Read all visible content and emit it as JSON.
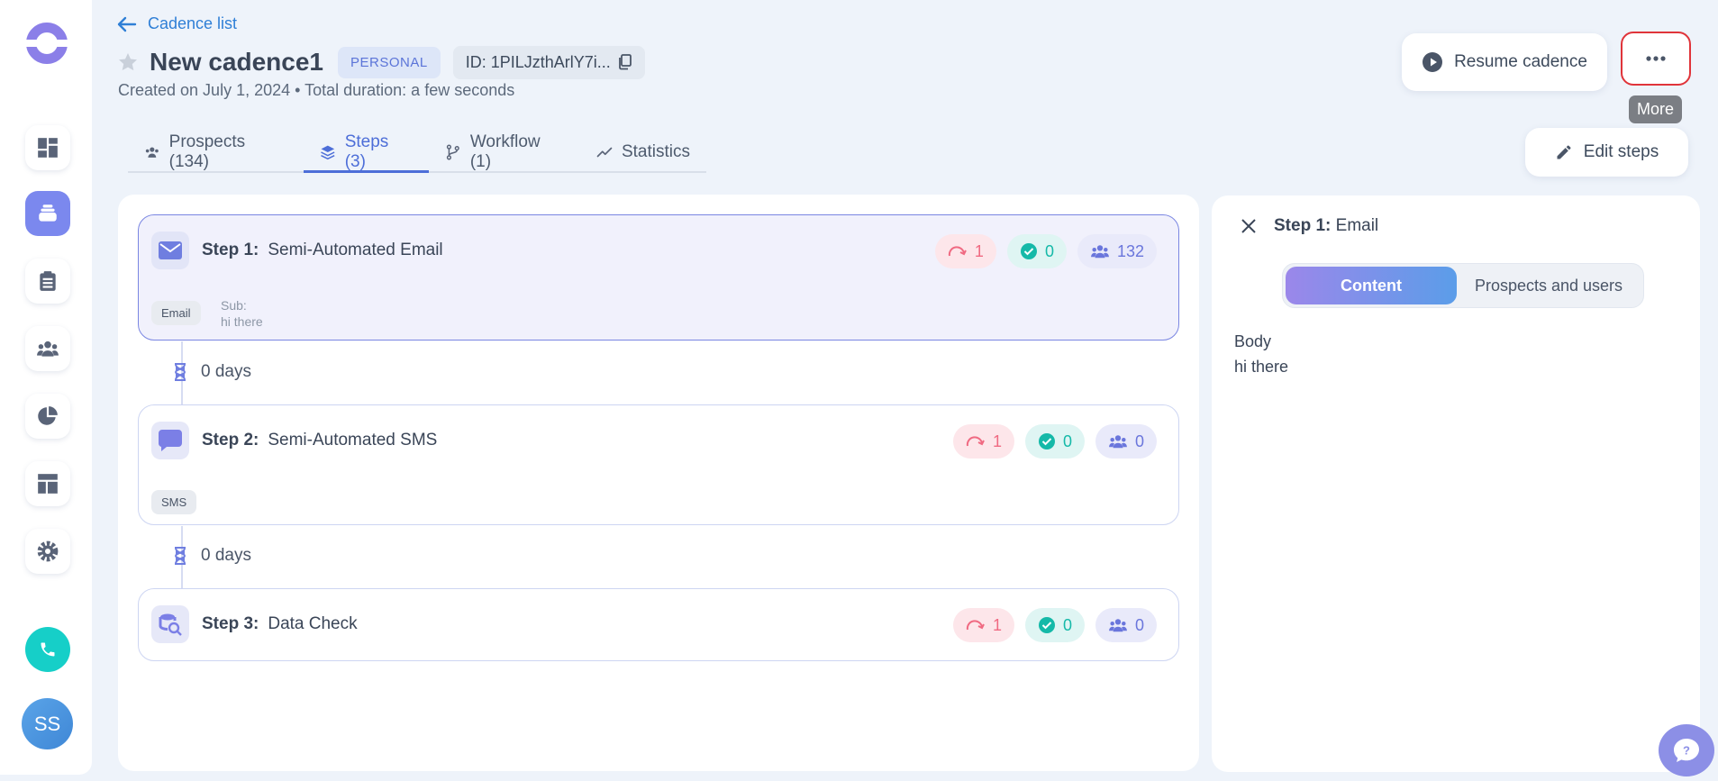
{
  "header": {
    "back_label": "Cadence list",
    "title": "New cadence1",
    "badge": "PERSONAL",
    "id_label": "ID: 1PILJzthArlY7i...",
    "meta": "Created on July 1, 2024 • Total duration: a few seconds",
    "resume_label": "Resume cadence",
    "more_tooltip": "More",
    "edit_label": "Edit steps"
  },
  "tabs": [
    {
      "label": "Prospects (134)",
      "icon": "users-icon",
      "active": false
    },
    {
      "label": "Steps (3)",
      "icon": "layers-icon",
      "active": true
    },
    {
      "label": "Workflow (1)",
      "icon": "workflow-icon",
      "active": false
    },
    {
      "label": "Statistics",
      "icon": "trend-icon",
      "active": false
    }
  ],
  "steps": [
    {
      "number": "Step 1:",
      "name": "Semi-Automated Email",
      "icon": "email-icon",
      "replied": "1",
      "completed": "0",
      "prospects": "132",
      "tag": "Email",
      "sub_label": "Sub:",
      "sub_value": "hi there"
    },
    {
      "number": "Step 2:",
      "name": "Semi-Automated SMS",
      "icon": "sms-icon",
      "replied": "1",
      "completed": "0",
      "prospects": "0",
      "tag": "SMS"
    },
    {
      "number": "Step 3:",
      "name": "Data Check",
      "icon": "data-check-icon",
      "replied": "1",
      "completed": "0",
      "prospects": "0"
    }
  ],
  "waits": [
    "0 days",
    "0 days"
  ],
  "side_panel": {
    "step_prefix": "Step 1:",
    "step_type": "Email",
    "segments": [
      "Content",
      "Prospects and users"
    ],
    "body_label": "Body",
    "body_text": "hi there"
  },
  "user": {
    "initials": "SS"
  },
  "colors": {
    "accent": "#4d6ed8",
    "more_border": "#e0343a",
    "phone": "#16cfc8"
  }
}
